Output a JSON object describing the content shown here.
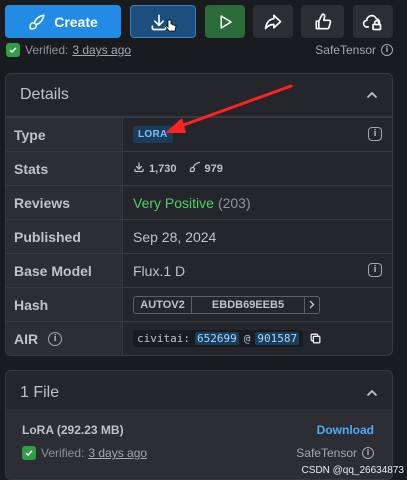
{
  "toolbar": {
    "create_label": "Create"
  },
  "verified": {
    "prefix": "Verified:",
    "when": "3 days ago",
    "format": "SafeTensor"
  },
  "details": {
    "title": "Details",
    "rows": {
      "type": {
        "label": "Type",
        "badge": "LORA"
      },
      "stats": {
        "label": "Stats",
        "downloads": "1,730",
        "generations": "979"
      },
      "reviews": {
        "label": "Reviews",
        "rating": "Very Positive",
        "count": "(203)"
      },
      "published": {
        "label": "Published",
        "value": "Sep 28, 2024"
      },
      "base_model": {
        "label": "Base Model",
        "value": "Flux.1 D"
      },
      "hash": {
        "label": "Hash",
        "type": "AUTOV2",
        "value": "EBDB69EEB5"
      },
      "air": {
        "label": "AIR",
        "prefix": "civitai:",
        "model_id": "652699",
        "at": "@",
        "version_id": "901587"
      }
    }
  },
  "files": {
    "title": "1 File",
    "file_name": "LoRA (292.23 MB)",
    "download_label": "Download",
    "verified_prefix": "Verified:",
    "verified_when": "3 days ago",
    "format": "SafeTensor"
  },
  "watermark": "CSDN @qq_26634873",
  "colors": {
    "primary": "#228be6",
    "success": "#2f9e44",
    "positive": "#51cf66",
    "link": "#4dabf7",
    "annotation_arrow": "#ff2222"
  }
}
